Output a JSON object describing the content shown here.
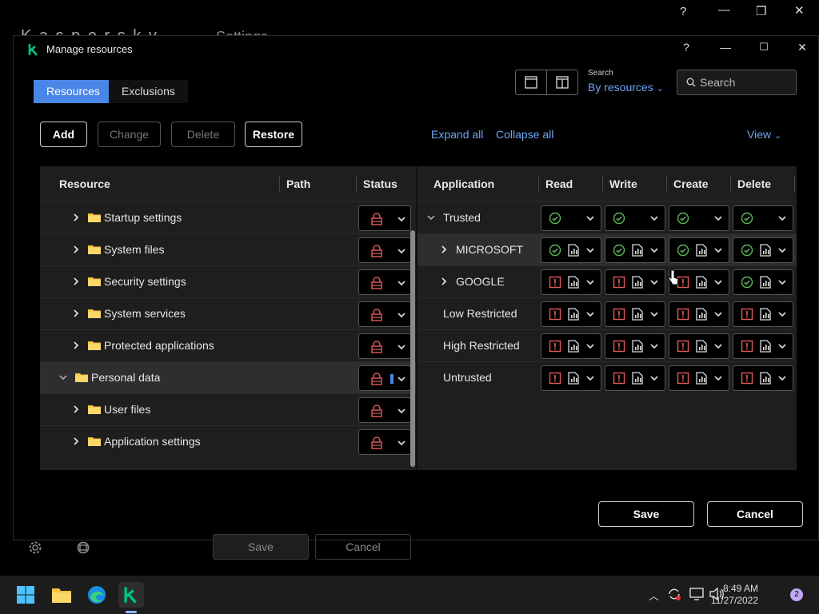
{
  "background": {
    "app_title": "K a s p e r s k y",
    "section_title": "Settings",
    "help": "?",
    "save_label": "Save",
    "cancel_label": "Cancel"
  },
  "dialog": {
    "title": "Manage resources",
    "help": "?",
    "tabs": [
      {
        "label": "Resources",
        "active": true
      },
      {
        "label": "Exclusions",
        "active": false
      }
    ],
    "search": {
      "by_label": "Search",
      "by_value": "By resources",
      "placeholder": "Search"
    },
    "toolbar": {
      "add": "Add",
      "change": "Change",
      "delete": "Delete",
      "restore": "Restore"
    },
    "links": {
      "expand_all": "Expand all",
      "collapse_all": "Collapse all",
      "view": "View"
    },
    "left_columns": {
      "resource": "Resource",
      "path": "Path",
      "status": "Status"
    },
    "right_columns": {
      "application": "Application",
      "read": "Read",
      "write": "Write",
      "create": "Create",
      "delete": "Delete"
    },
    "resources": [
      {
        "label": "Startup settings",
        "level": 1,
        "expanded": false,
        "selected": false
      },
      {
        "label": "System files",
        "level": 1,
        "expanded": false,
        "selected": false
      },
      {
        "label": "Security settings",
        "level": 1,
        "expanded": false,
        "selected": false
      },
      {
        "label": "System services",
        "level": 1,
        "expanded": false,
        "selected": false
      },
      {
        "label": "Protected applications",
        "level": 1,
        "expanded": false,
        "selected": false
      },
      {
        "label": "Personal data",
        "level": 0,
        "expanded": true,
        "selected": true
      },
      {
        "label": "User files",
        "level": 1,
        "expanded": false,
        "selected": false
      },
      {
        "label": "Application settings",
        "level": 1,
        "expanded": false,
        "selected": false
      }
    ],
    "applications": [
      {
        "label": "Trusted",
        "chevron": "down",
        "indent": 0,
        "selected": false,
        "perms": [
          "allow",
          "allow",
          "allow",
          "allow"
        ],
        "log": false
      },
      {
        "label": "MICROSOFT",
        "chevron": "right",
        "indent": 1,
        "selected": true,
        "perms": [
          "allow",
          "allow",
          "allow",
          "allow"
        ],
        "log": true
      },
      {
        "label": "GOOGLE",
        "chevron": "right",
        "indent": 1,
        "selected": false,
        "perms": [
          "deny",
          "deny",
          "deny",
          "allow"
        ],
        "log": true
      },
      {
        "label": "Low Restricted",
        "chevron": "none",
        "indent": 0,
        "selected": false,
        "perms": [
          "deny",
          "deny",
          "deny",
          "deny"
        ],
        "log": true
      },
      {
        "label": "High Restricted",
        "chevron": "none",
        "indent": 0,
        "selected": false,
        "perms": [
          "deny",
          "deny",
          "deny",
          "deny"
        ],
        "log": true
      },
      {
        "label": "Untrusted",
        "chevron": "none",
        "indent": 0,
        "selected": false,
        "perms": [
          "deny",
          "deny",
          "deny",
          "deny"
        ],
        "log": true
      }
    ],
    "save": "Save",
    "cancel": "Cancel"
  },
  "taskbar": {
    "time": "8:49 AM",
    "date": "11/27/2022",
    "notifications": "2"
  },
  "colors": {
    "accent": "#4a86e8",
    "link": "#6fa4f2",
    "allow": "#5cb85c",
    "deny": "#e05a5a"
  }
}
